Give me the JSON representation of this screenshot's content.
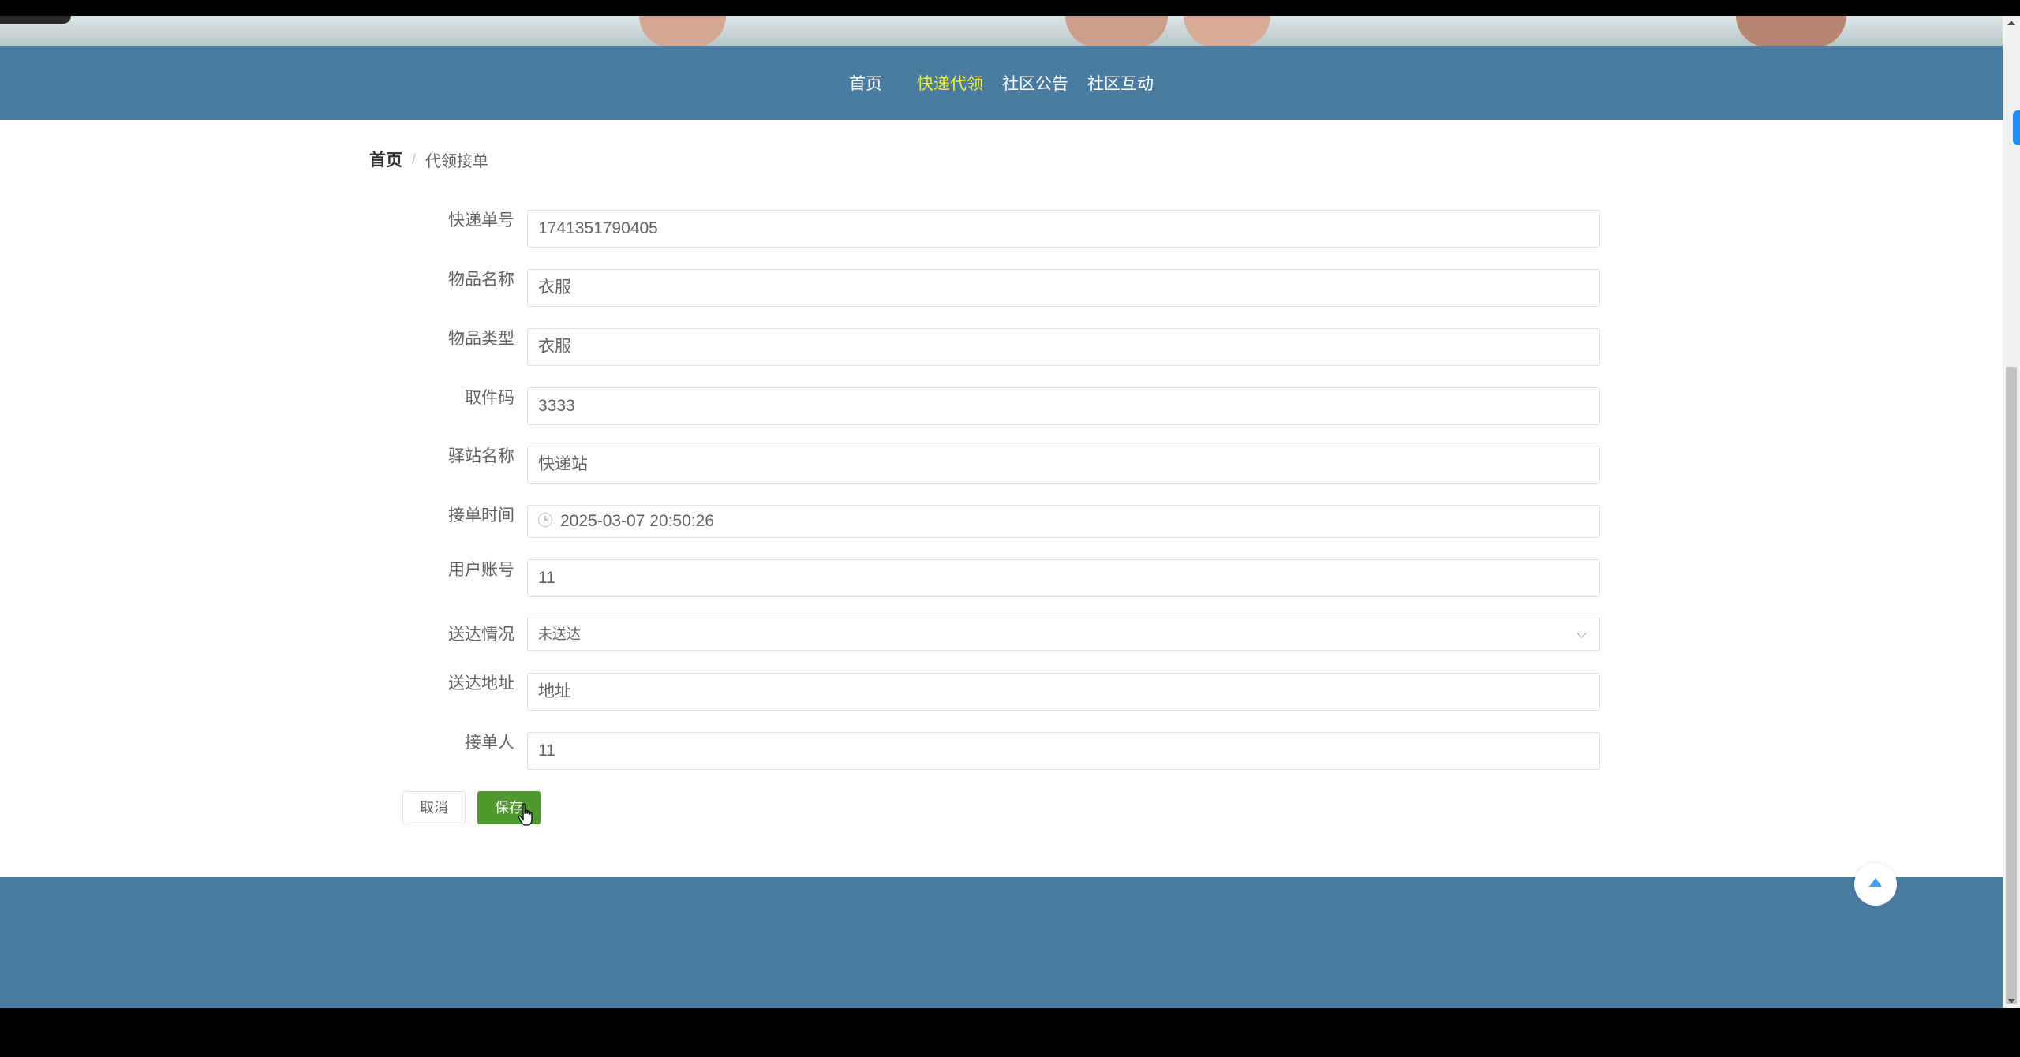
{
  "nav": {
    "items": [
      {
        "label": "首页",
        "active": false
      },
      {
        "label": "快递代领",
        "active": true
      },
      {
        "label": "社区公告",
        "active": false
      },
      {
        "label": "社区互动",
        "active": false
      }
    ]
  },
  "breadcrumb": {
    "home": "首页",
    "separator": "/",
    "current": "代领接单"
  },
  "form": {
    "fields": [
      {
        "label": "快递单号",
        "value": "1741351790405",
        "type": "text"
      },
      {
        "label": "物品名称",
        "value": "衣服",
        "type": "text"
      },
      {
        "label": "物品类型",
        "value": "衣服",
        "type": "text"
      },
      {
        "label": "取件码",
        "value": "3333",
        "type": "text"
      },
      {
        "label": "驿站名称",
        "value": "快递站",
        "type": "text"
      },
      {
        "label": "接单时间",
        "value": "2025-03-07 20:50:26",
        "type": "datetime"
      },
      {
        "label": "用户账号",
        "value": "11",
        "type": "text"
      },
      {
        "label": "送达情况",
        "value": "未送达",
        "type": "select"
      },
      {
        "label": "送达地址",
        "value": "地址",
        "type": "text"
      },
      {
        "label": "接单人",
        "value": "11",
        "type": "text"
      }
    ]
  },
  "buttons": {
    "cancel": "取消",
    "save": "保存"
  },
  "colors": {
    "nav_bg": "#4a7ba0",
    "nav_active": "#f3ee2f",
    "save_button": "#4e9a2e",
    "back_top_arrow": "#409eff"
  },
  "icons": {
    "datetime": "clock-icon",
    "select": "chevron-down-icon",
    "back_top": "caret-up-icon"
  }
}
